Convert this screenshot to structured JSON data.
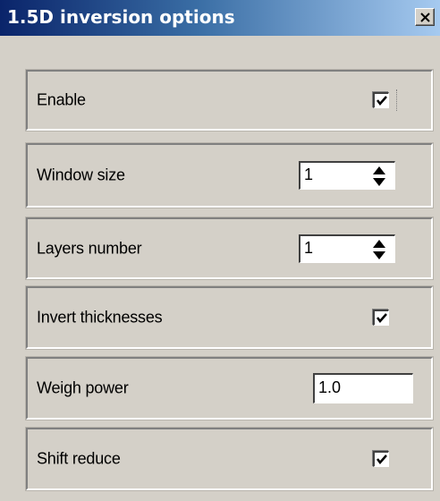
{
  "window": {
    "title": "1.5D inversion options"
  },
  "options": {
    "enable": {
      "label": "Enable",
      "checked": true
    },
    "window_size": {
      "label": "Window size",
      "value": "1"
    },
    "layers_number": {
      "label": "Layers number",
      "value": "1"
    },
    "invert_thicknesses": {
      "label": "Invert thicknesses",
      "checked": true
    },
    "weigh_power": {
      "label": "Weigh power",
      "value": "1.0"
    },
    "shift_reduce": {
      "label": "Shift reduce",
      "checked": true
    }
  },
  "icons": {
    "close": "close-icon",
    "check": "checkmark-icon",
    "spin_up": "arrow-up-icon",
    "spin_down": "arrow-down-icon"
  },
  "colors": {
    "face": "#d4d0c8",
    "title_gradient_start": "#0a246a",
    "title_gradient_end": "#a6caf0",
    "title_text": "#ffffff"
  }
}
